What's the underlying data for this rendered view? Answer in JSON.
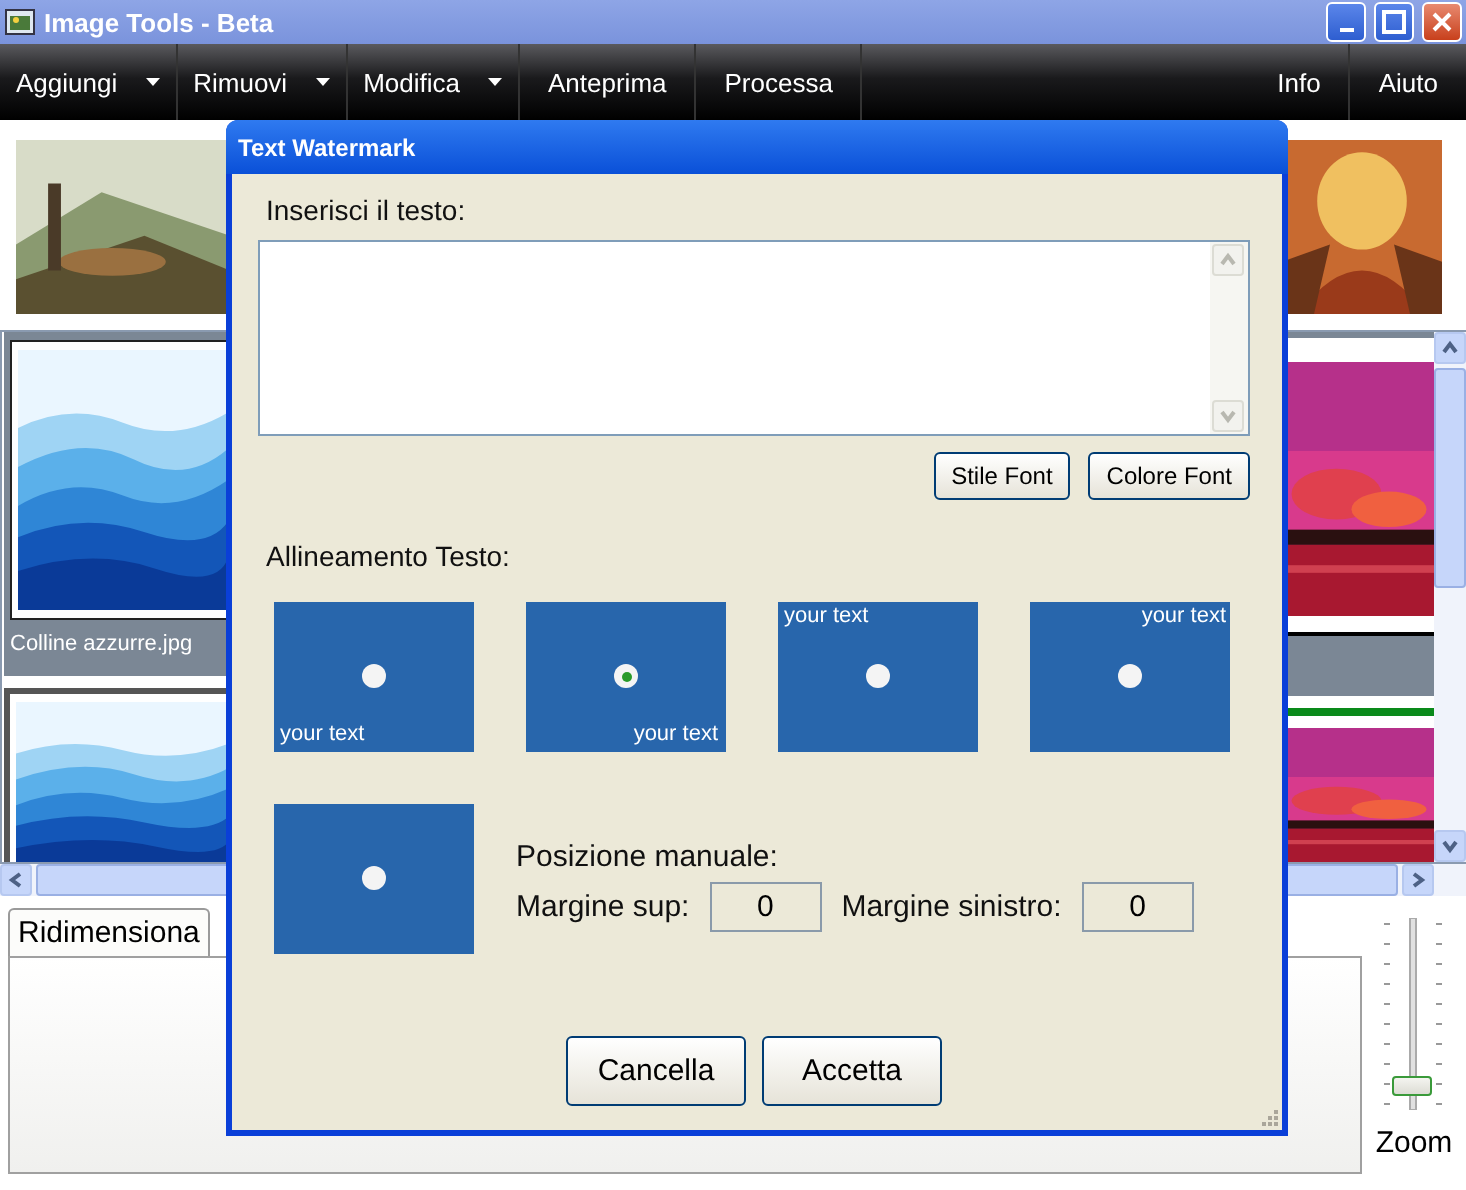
{
  "window": {
    "title": "Image Tools - Beta"
  },
  "menu": [
    {
      "label": "Aggiungi",
      "dropdown": true
    },
    {
      "label": "Rimuovi",
      "dropdown": true
    },
    {
      "label": "Modifica",
      "dropdown": true
    },
    {
      "label": "Anteprima",
      "dropdown": false
    },
    {
      "label": "Processa",
      "dropdown": false
    },
    {
      "label": "Info",
      "dropdown": false
    },
    {
      "label": "Aiuto",
      "dropdown": false
    }
  ],
  "gallery": {
    "caption": "Colline azzurre.jpg"
  },
  "bottom_tabs": [
    {
      "label": "Ridimensiona",
      "selected": true
    }
  ],
  "zoom": {
    "label": "Zoom",
    "level": 0.08
  },
  "dialog": {
    "title": "Text Watermark",
    "text_label": "Inserisci il testo:",
    "font_buttons": [
      "Stile Font",
      "Colore Font"
    ],
    "alignment_label": "Allineamento Testo:",
    "alignments": [
      {
        "kind": "bottom-left",
        "sample": "your text",
        "selected": false
      },
      {
        "kind": "bottom-right",
        "sample": "your text",
        "selected": true
      },
      {
        "kind": "top-left",
        "sample": "your text",
        "selected": false
      },
      {
        "kind": "top-right",
        "sample": "your text",
        "selected": false
      },
      {
        "kind": "manual",
        "selected": false
      }
    ],
    "manual": {
      "label": "Posizione manuale:",
      "top_label": "Margine sup:",
      "top_value": "0",
      "left_label": "Margine sinistro:",
      "left_value": "0"
    },
    "buttons": [
      "Cancella",
      "Accetta"
    ]
  }
}
